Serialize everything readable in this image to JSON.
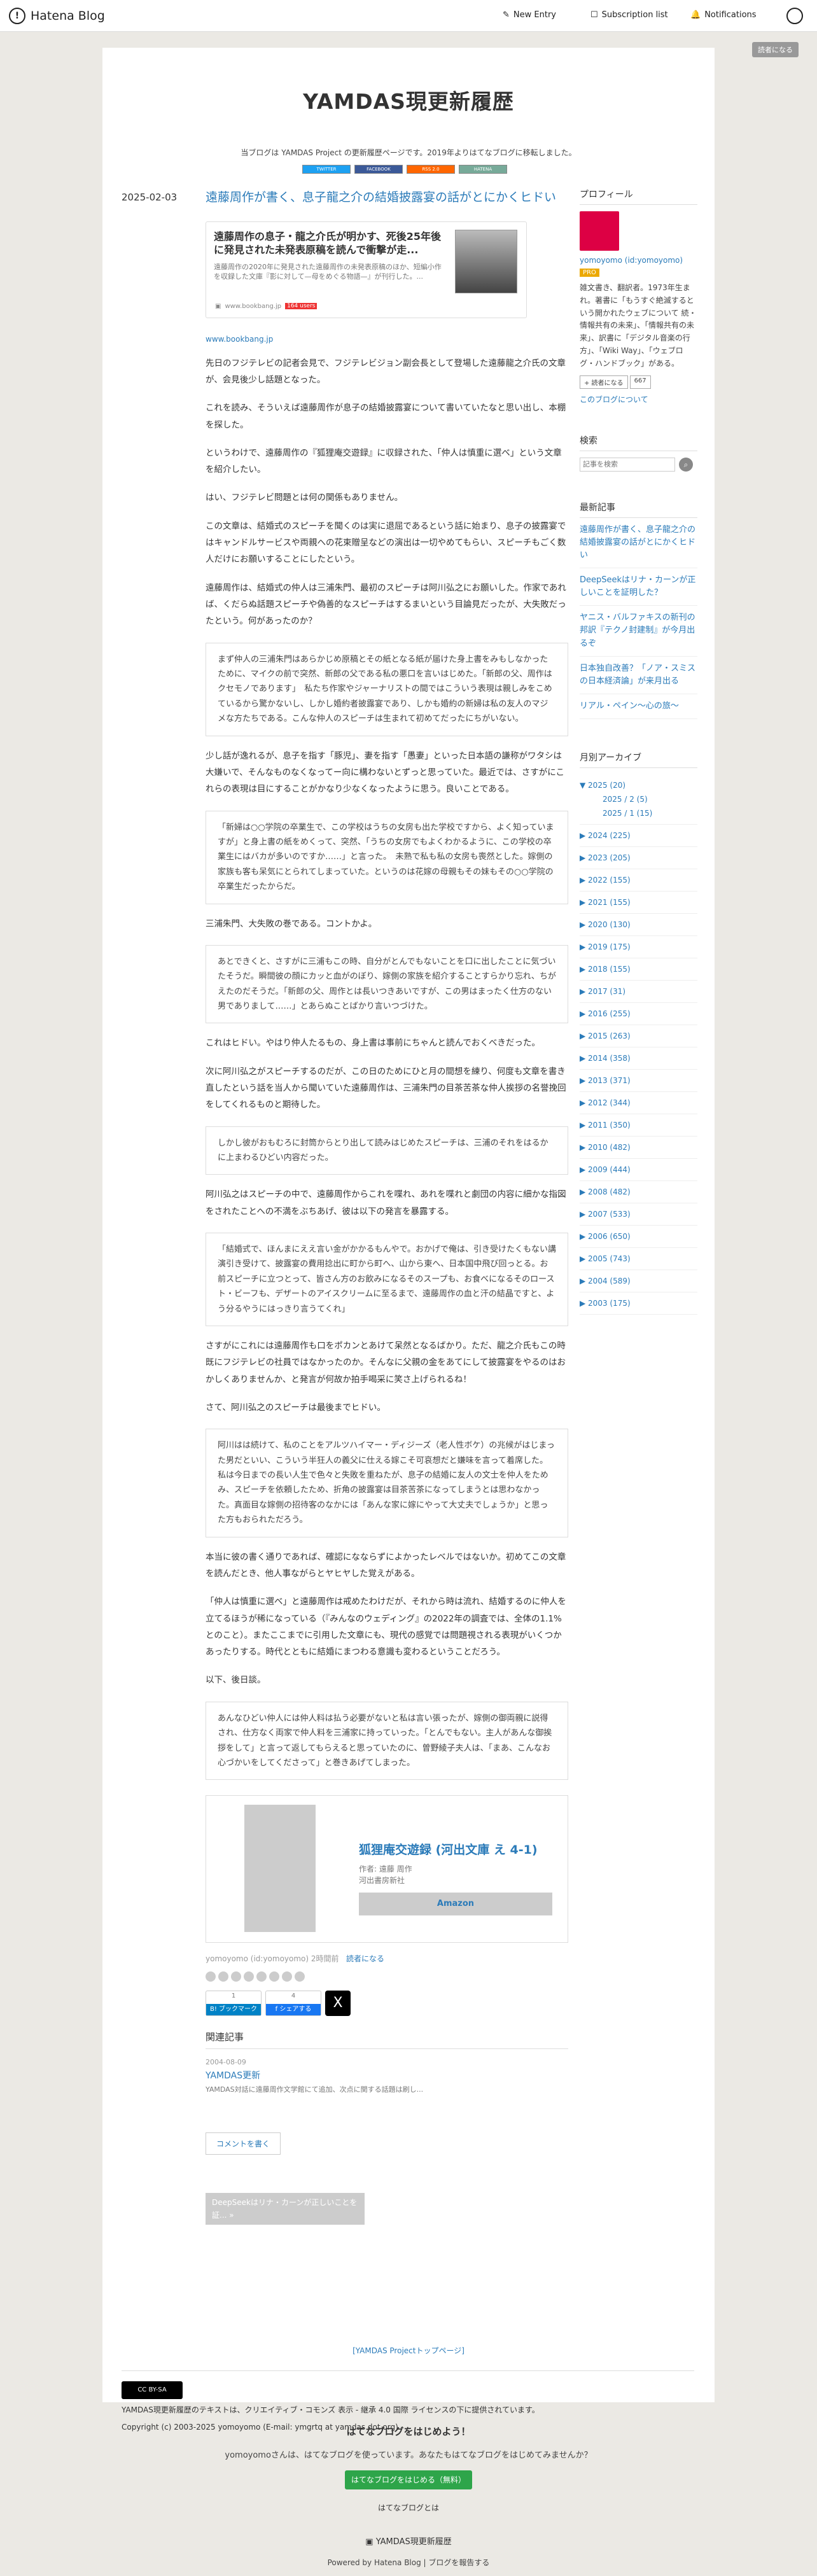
{
  "global_nav": {
    "logo": "Hatena Blog",
    "new_entry": "New Entry",
    "subscription_list": "Subscription list",
    "notifications": "Notifications"
  },
  "reader_button": "読者になる",
  "blog": {
    "title": "YAMDAS現更新履歴",
    "description": "当ブログは YAMDAS Project の更新履歴ページです。2019年よりはてなブログに移転しました。",
    "badges": [
      "TWITTER",
      "FACEBOOK",
      "RSS 2.0",
      "HATENA"
    ]
  },
  "entry": {
    "date": "2025-02-03",
    "title": "遠藤周作が書く、息子龍之介の結婚披露宴の話がとにかくヒドい",
    "embed": {
      "title": "遠藤周作の息子・龍之介氏が明かす、死後25年後に発見された未発表原稿を読んで衝撃が走...",
      "text": "遠藤周作の2020年に発見された遠藤周作の未発表原稿のほか、短編小作を収録した文庫『影に対して—母をめぐる物語—』が刊行した。...",
      "site": "www.bookbang.jp",
      "users": "164 users"
    },
    "source_link": "www.bookbang.jp",
    "paragraphs": [
      "先日のフジテレビの記者会見で、フジテレビジョン副会長として登場した遠藤龍之介氏の文章が、会見後少し話題となった。",
      "これを読み、そういえば遠藤周作が息子の結婚披露宴について書いていたなと思い出し、本棚を探した。",
      "というわけで、遠藤周作の『狐狸庵交遊録』に収録された、「仲人は慎重に選べ」という文章を紹介したい。",
      "はい、フジテレビ問題とは何の関係もありません。",
      "この文章は、結婚式のスピーチを聞くのは実に退屈であるという話に始まり、息子の披露宴ではキャンドルサービスや両親への花束贈呈などの演出は一切やめてもらい、スピーチもごく数人だけにお願いすることにしたという。",
      "遠藤周作は、結婚式の仲人は三浦朱門、最初のスピーチは阿川弘之にお願いした。作家であれば、くだらぬ話題スピーチや偽善的なスピーチはするまいという目論見だったが、大失敗だったという。何があったのか？"
    ],
    "quote1": "まず仲人の三浦朱門はあらかじめ原稿とその紙となる紙が届けた身上書をみもしなかったために、マイクの前で突然、新郎の父である私の悪口を言いはじめた。「新郎の父、周作はクセモノであります」　私たち作家やジャーナリストの間ではこういう表現は親しみをこめているから驚かないし、しかし婚約者披露宴であり、しかも婚約の新婦は私の友人のマジメな方たちである。こんな仲人のスピーチは生まれて初めてだったにちがいない。",
    "paragraph2": "少し話が逸れるが、息子を指す「豚児」、妻を指す「愚妻」といった日本語の謙称がワタシは大嫌いで、そんなものなくなってー向に構わないとずっと思っていた。最近では、さすがにこれらの表現は目にすることがかなり少なくなったように思う。良いことである。",
    "quote2": "「新婦は○○学院の卒業生で、この学校はうちの女房も出た学校ですから、よく知っていますが」と身上書の紙をめくって、突然、「うちの女房でもよくわかるように、この学校の卒業生にはバカが多いのですか……」と言った。　未熟で私も私の女房も喪然とした。嫁側の家族も客も呆気にとられてしまっていた。というのは花嫁の母親もその妹もその○○学院の卒業生だったからだ。",
    "paragraph3": "三浦朱門、大失敗の巻である。コントかよ。",
    "quote3": "あとできくと、さすがに三浦もこの時、自分がとんでもないことを口に出したことに気づいたそうだ。瞬間彼の顔にカッと血がのぼり、嫁側の家族を紹介することすらかり忘れ、ちがえたのだそうだ。「新郎の父、周作とは長いつきあいですが、この男はまったく仕方のない男でありまして……」とあらぬことばかり言いつづけた。",
    "paragraph4": "これはヒドい。やはり仲人たるもの、身上書は事前にちゃんと読んでおくべきだった。",
    "paragraph5": "次に阿川弘之がスピーチするのだが、この日のためにひと月の間想を練り、何度も文章を書き直したという話を当人から聞いていた遠藤周作は、三浦朱門の目茶苦茶な仲人挨拶の名誉挽回をしてくれるものと期待した。",
    "quote4": "しかし彼がおもむろに封筒からとり出して読みはじめたスピーチは、三浦のそれをはるかに上まわるひどい内容だった。",
    "paragraph6": "阿川弘之はスピーチの中で、遠藤周作からこれを喋れ、あれを喋れと劇団の内容に細かな指図をされたことへの不満をぶちあげ、彼は以下の発言を暴露する。",
    "quote5": "「結婚式で、ほんまにええ言い金がかかるもんやで。おかげで俺は、引き受けたくもない講演引き受けて、披露宴の費用捻出に町から町へ、山から東へ、日本国中飛び回っとる。お前スピーチに立つとって、皆さん方のお飲みになるそのスープも、お食べになるそのロースト・ビーフも、デザートのアイスクリームに至るまで、遠藤周作の血と汗の結晶ですと、よう分るやうにはっきり言うてくれ」",
    "paragraph7": "さすがにこれには遠藤周作も口をポカンとあけて呆然となるばかり。ただ、龍之介氏もこの時既にフジテレビの社員ではなかったのか。そんなに父親の金をあてにして披露宴をやるのはおかしくありませんか、と発言が何故か拍手喝采に笑さ上げられるね！",
    "paragraph8": "さて、阿川弘之のスピーチは最後までヒドい。",
    "quote6": "阿川はは続けて、私のことをアルツハイマー・ディジーズ（老人性ボケ）の兆候がはじまった男だといい、こういう半狂人の義父に仕える嫁こそ可哀想だと嫌味を言って着席した。　私は今日までの長い人生で色々と失敗を重ねたが、息子の結婚に友人の文士を仲人をためみ、スピーチを依頼したため、折角の披露宴は目茶苦茶になってしまうとは思わなかった。真面目な嫁側の招待客のなかには「あんな家に嫁にやって大丈夫でしょうか」と思った方もおられただろう。",
    "paragraph9": "本当に彼の書く通りであれば、確認になならずによかったレベルではないか。初めてこの文章を読んだとき、他人事ながらとヤヒヤした覚えがある。",
    "paragraph10": "「仲人は慎重に選べ」と遠藤周作は戒めたわけだが、それから時は流れ、結婚するのに仲人を立てるほうが稀になっている（『みんなのウェディング』の2022年の調査では、全体の1.1%とのこと）。またここまでに引用した文章にも、現代の感覚では問題視される表現がいくつかあったりする。時代とともに結婚にまつわる意識も変わるということだろう。",
    "paragraph11": "以下、後日談。",
    "quote7": "あんなひどい仲人には仲人料は払う必要がないと私は言い張ったが、嫁側の御両親に説得され、仕方なく両家で仲人料を三浦家に持っていった。「とんでもない。主人があんな御挨拶をして」と言って返してもらえると思っていたのに、曽野綾子夫人は、「まあ、こんなお心づかいをしてくださって」と巻きあげてしまった。",
    "book": {
      "title": "狐狸庵交遊録 (河出文庫 え 4-1)",
      "author": "作者: 遠藤 周作",
      "publisher": "河出書房新社",
      "button": "Amazon"
    },
    "footer": {
      "author": "yomoyomo (id:yomoyomo) 2時間前",
      "reader": "読者になる"
    },
    "share": {
      "hatena_count": "1",
      "hatena_label": "B! ブックマーク",
      "fb_count": "4",
      "fb_label": "f シェアする",
      "x_label": "X"
    },
    "related": {
      "heading": "関連記事",
      "date": "2004-08-09",
      "title": "YAMDAS更新",
      "text": "YAMDAS対話に遠藤周作文学館にて追加、次点に関する話題は刷し..."
    },
    "comment_button": "コメントを書く",
    "pager": "DeepSeekはリナ・カーンが正しいことを証... »"
  },
  "top_link": "[YAMDAS Projectトップページ]",
  "sidebar": {
    "profile_heading": "プロフィール",
    "profile_name": "yomoyomo (id:yomoyomo)",
    "pro_badge": "PRO",
    "profile_desc": "雑文書き、翻訳者。1973年生まれ。著書に「もうすぐ絶滅するという開かれたウェブについて 続・情報共有の未来」、「情報共有の未来」、訳書に「デジタル音楽の行方」、「Wiki Way」、「ウェブログ・ハンドブック」がある。",
    "subscribe": "+ 読者になる",
    "subscribers": "667",
    "about": "このブログについて",
    "search_heading": "検索",
    "search_placeholder": "記事を検索",
    "recent_heading": "最新記事",
    "recent": [
      "遠藤周作が書く、息子龍之介の結婚披露宴の話がとにかくヒドい",
      "DeepSeekはリナ・カーンが正しいことを証明した？",
      "ヤニス・バルファキスの新刊の邦訳『テクノ封建制』が今月出るぞ",
      "日本独自改善？「ノア・スミスの日本経済論」が来月出る",
      "リアル・ペイン～心の旅～"
    ],
    "archive_heading": "月別アーカイブ",
    "archive_open": "▼ 2025 (20)",
    "archive_sub": [
      "2025 / 2 (5)",
      "2025 / 1 (15)"
    ],
    "archive": [
      "▶ 2024 (225)",
      "▶ 2023 (205)",
      "▶ 2022 (155)",
      "▶ 2021 (155)",
      "▶ 2020 (130)",
      "▶ 2019 (175)",
      "▶ 2018 (155)",
      "▶ 2017 (31)",
      "▶ 2016 (255)",
      "▶ 2015 (263)",
      "▶ 2014 (358)",
      "▶ 2013 (371)",
      "▶ 2012 (344)",
      "▶ 2011 (350)",
      "▶ 2010 (482)",
      "▶ 2009 (444)",
      "▶ 2008 (482)",
      "▶ 2007 (533)",
      "▶ 2006 (650)",
      "▶ 2005 (743)",
      "▶ 2004 (589)",
      "▶ 2003 (175)"
    ]
  },
  "license": {
    "cc_label": "CC BY-SA",
    "text": "YAMDAS現更新履歴のテキストは、クリエイティブ・コモンズ 表示 - 継承 4.0 国際 ライセンスの下に提供されています。",
    "copyright": "Copyright (c) 2003-2025 yomoyomo (E-mail: ymgrtq at yamdas dot org)"
  },
  "footer": {
    "heading": "はてなブログをはじめよう！",
    "text": "yomoyomoさんは、はてなブログを使っています。あなたもはてなブログをはじめてみませんか？",
    "button": "はてなブログをはじめる（無料）",
    "about": "はてなブログとは",
    "blog_name": "YAMDAS現更新履歴",
    "powered": "Powered by Hatena Blog | ブログを報告する"
  }
}
